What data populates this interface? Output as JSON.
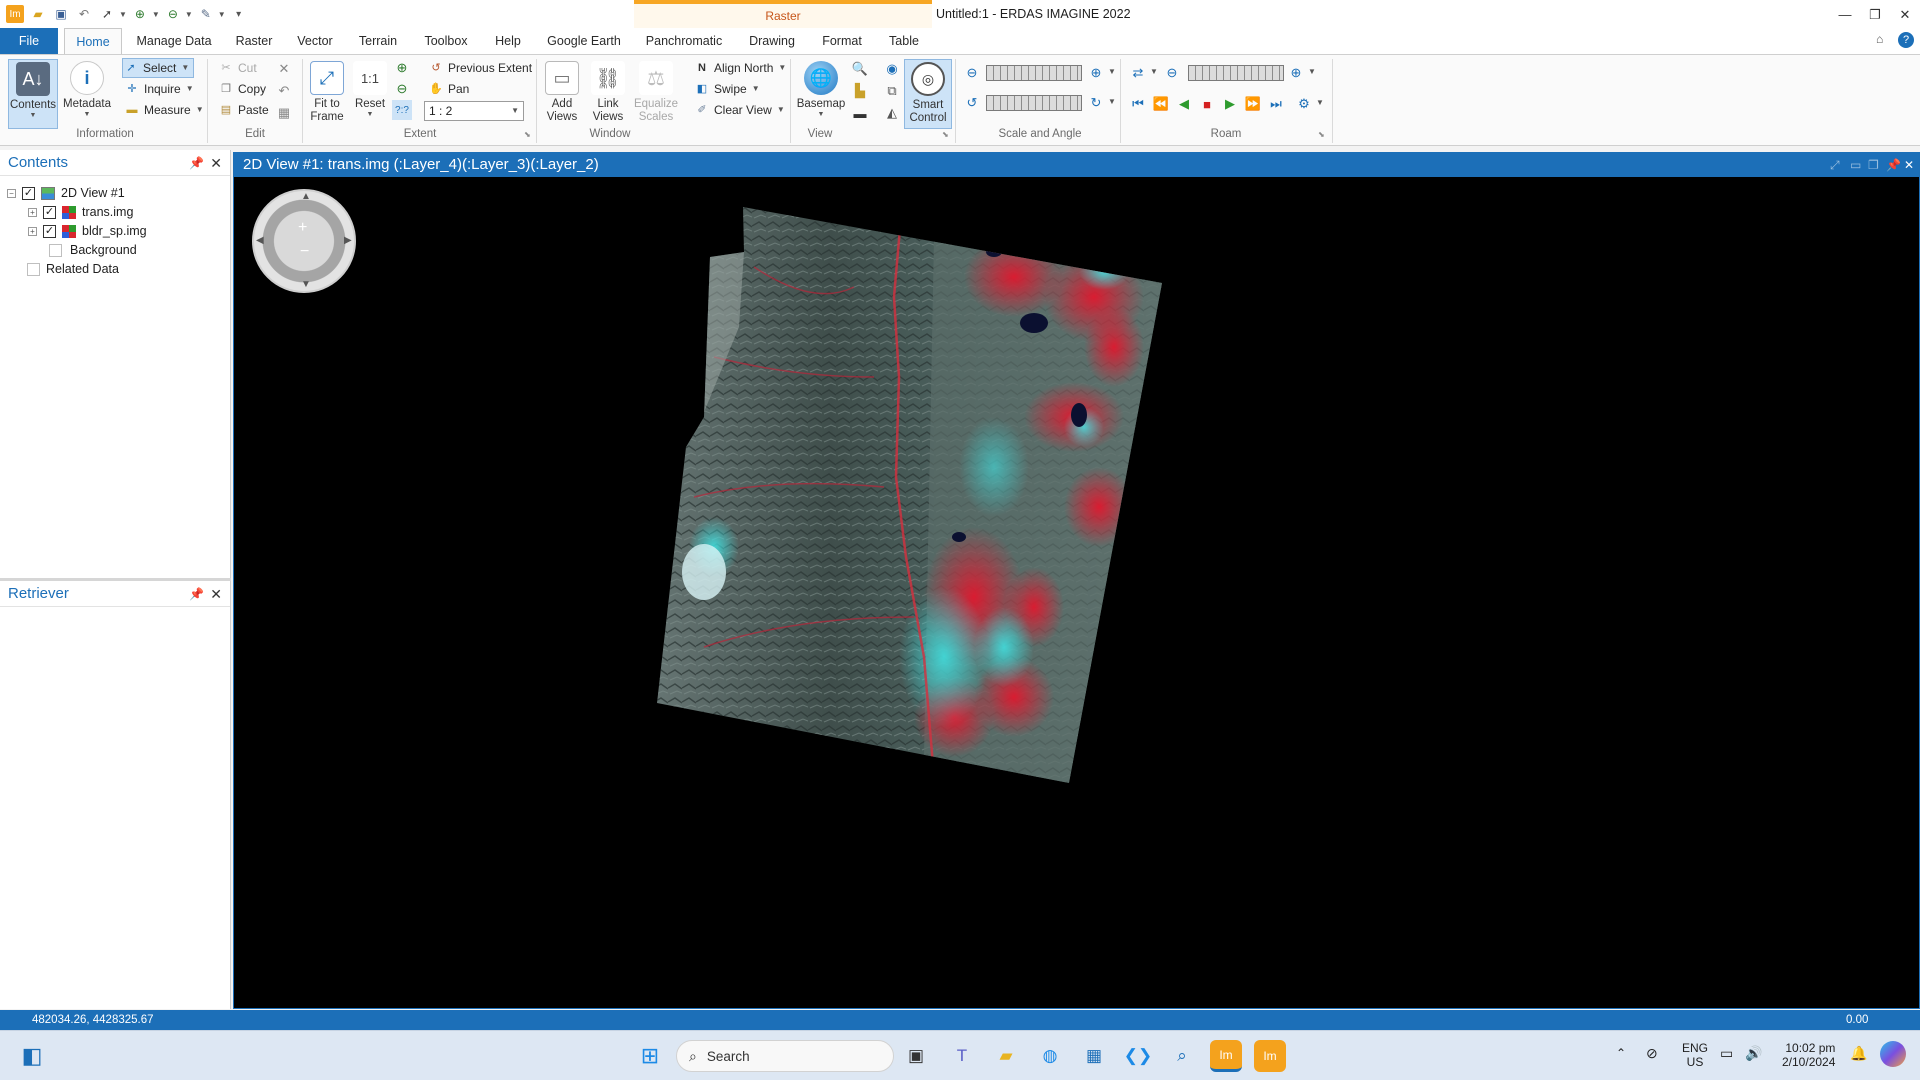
{
  "title_bar": {
    "app_title": "Untitled:1 - ERDAS IMAGINE 2022",
    "context_tab": "Raster",
    "quick_access_icons": [
      "app-logo-icon",
      "open-folder-icon",
      "save-icon",
      "undo-icon",
      "select-arrow-icon",
      "zoom-in-icon",
      "zoom-out-icon",
      "measure-icon",
      "customize-icon"
    ],
    "window_controls": {
      "minimize": "—",
      "restore": "❐",
      "close": "✕"
    }
  },
  "ribbon_tabs": [
    "File",
    "Home",
    "Manage Data",
    "Raster",
    "Vector",
    "Terrain",
    "Toolbox",
    "Help",
    "Google Earth",
    "Panchromatic",
    "Drawing",
    "Format",
    "Table"
  ],
  "ribbon": {
    "information": {
      "label": "Information",
      "contents": "Contents",
      "metadata": "Metadata",
      "select": "Select",
      "inquire": "Inquire",
      "measure": "Measure"
    },
    "edit": {
      "label": "Edit",
      "cut": "Cut",
      "copy": "Copy",
      "paste": "Paste"
    },
    "extent": {
      "label": "Extent",
      "fit_to_frame_1": "Fit to",
      "fit_to_frame_2": "Frame",
      "reset": "Reset",
      "previous_extent": "Previous Extent",
      "pan": "Pan",
      "scale_value": "1 : 2"
    },
    "window": {
      "label": "Window",
      "add_views_1": "Add",
      "add_views_2": "Views",
      "link_views_1": "Link",
      "link_views_2": "Views",
      "equalize_1": "Equalize",
      "equalize_2": "Scales",
      "align_north": "Align North",
      "swipe": "Swipe",
      "clear_view": "Clear View"
    },
    "view": {
      "label": "View",
      "basemap": "Basemap",
      "smart_control_1": "Smart",
      "smart_control_2": "Control"
    },
    "scale_angle": {
      "label": "Scale and Angle"
    },
    "roam": {
      "label": "Roam"
    }
  },
  "contents_pane": {
    "title": "Contents",
    "tree": {
      "view": "2D View #1",
      "layer1": "trans.img",
      "layer2": "bldr_sp.img",
      "background": "Background",
      "related": "Related Data"
    }
  },
  "retriever_pane": {
    "title": "Retriever"
  },
  "view_window": {
    "title": "2D View #1: trans.img (:Layer_4)(:Layer_3)(:Layer_2)"
  },
  "status_bar": {
    "coordinates": "482034.26, 4428325.67",
    "rotation": "0.00"
  },
  "taskbar": {
    "search_placeholder": "Search",
    "lang_1": "ENG",
    "lang_2": "US",
    "time": "10:02 pm",
    "date": "2/10/2024"
  },
  "colors": {
    "accent_blue": "#1c6fb8",
    "context_orange": "#f7a623",
    "image_red": "#e0182e",
    "image_cyan": "#3fe6e6"
  }
}
